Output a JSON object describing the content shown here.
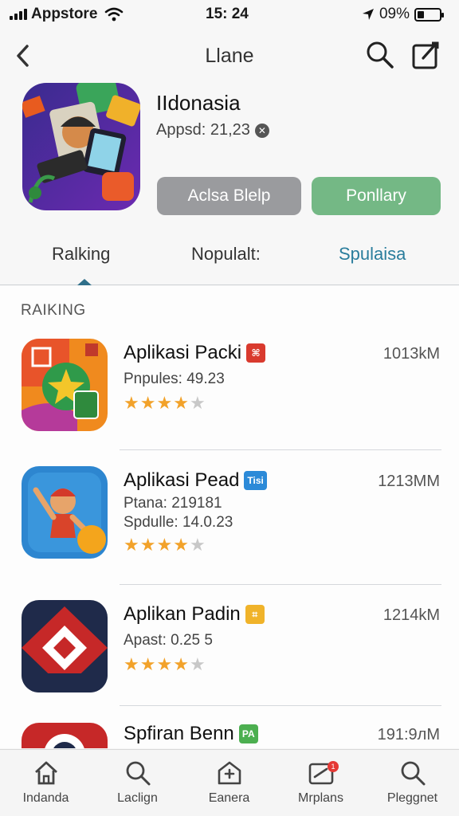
{
  "status_bar": {
    "carrier": "Appstore",
    "time": "15: 24",
    "battery_percent": "09%"
  },
  "nav": {
    "title": "Llane"
  },
  "app": {
    "name": "IIdonasia",
    "meta": "Appsd: 21,23",
    "button_secondary": "Aclsa Blelp",
    "button_primary": "Ponllary"
  },
  "tabs": [
    {
      "label": "Ralking"
    },
    {
      "label": "Nopulalt:"
    },
    {
      "label": "Spulaisa"
    }
  ],
  "active_tab": "Ralking",
  "list": {
    "section_label": "RAIKING",
    "items": [
      {
        "name": "Aplikasi Packi",
        "badge": "",
        "badge_color": "#d93a2e",
        "sub1": "Pnpules: 49.23",
        "sub2": "",
        "size": "1013kM",
        "rating": 4
      },
      {
        "name": "Aplikasi Pead",
        "badge": "Tisi",
        "badge_color": "#2c8ad8",
        "sub1": "Ptana: 219181",
        "sub2": "Spdulle: 14.0.23",
        "size": "1213MM",
        "rating": 4
      },
      {
        "name": "Aplikan Padin",
        "badge": "",
        "badge_color": "#f0b32a",
        "sub1": "Apast: 0.25 5",
        "sub2": "",
        "size": "1214kM",
        "rating": 4
      },
      {
        "name": "Spfiran Benn",
        "badge": "PA",
        "badge_color": "#4caf50",
        "sub1": "",
        "sub2": "",
        "size": "191:9лM",
        "rating": 0
      }
    ]
  },
  "tab_bar": [
    {
      "label": "Indanda",
      "icon": "home-icon"
    },
    {
      "label": "Laclign",
      "icon": "search-icon"
    },
    {
      "label": "Eanera",
      "icon": "house-plus-icon"
    },
    {
      "label": "Mrplans",
      "icon": "updates-icon",
      "badge": "1"
    },
    {
      "label": "Pleggnet",
      "icon": "search-icon"
    }
  ],
  "colors": {
    "accent": "#2a7d9c",
    "primary_button": "#74b885",
    "secondary_button": "#9a9b9e",
    "star": "#f2a22a"
  }
}
